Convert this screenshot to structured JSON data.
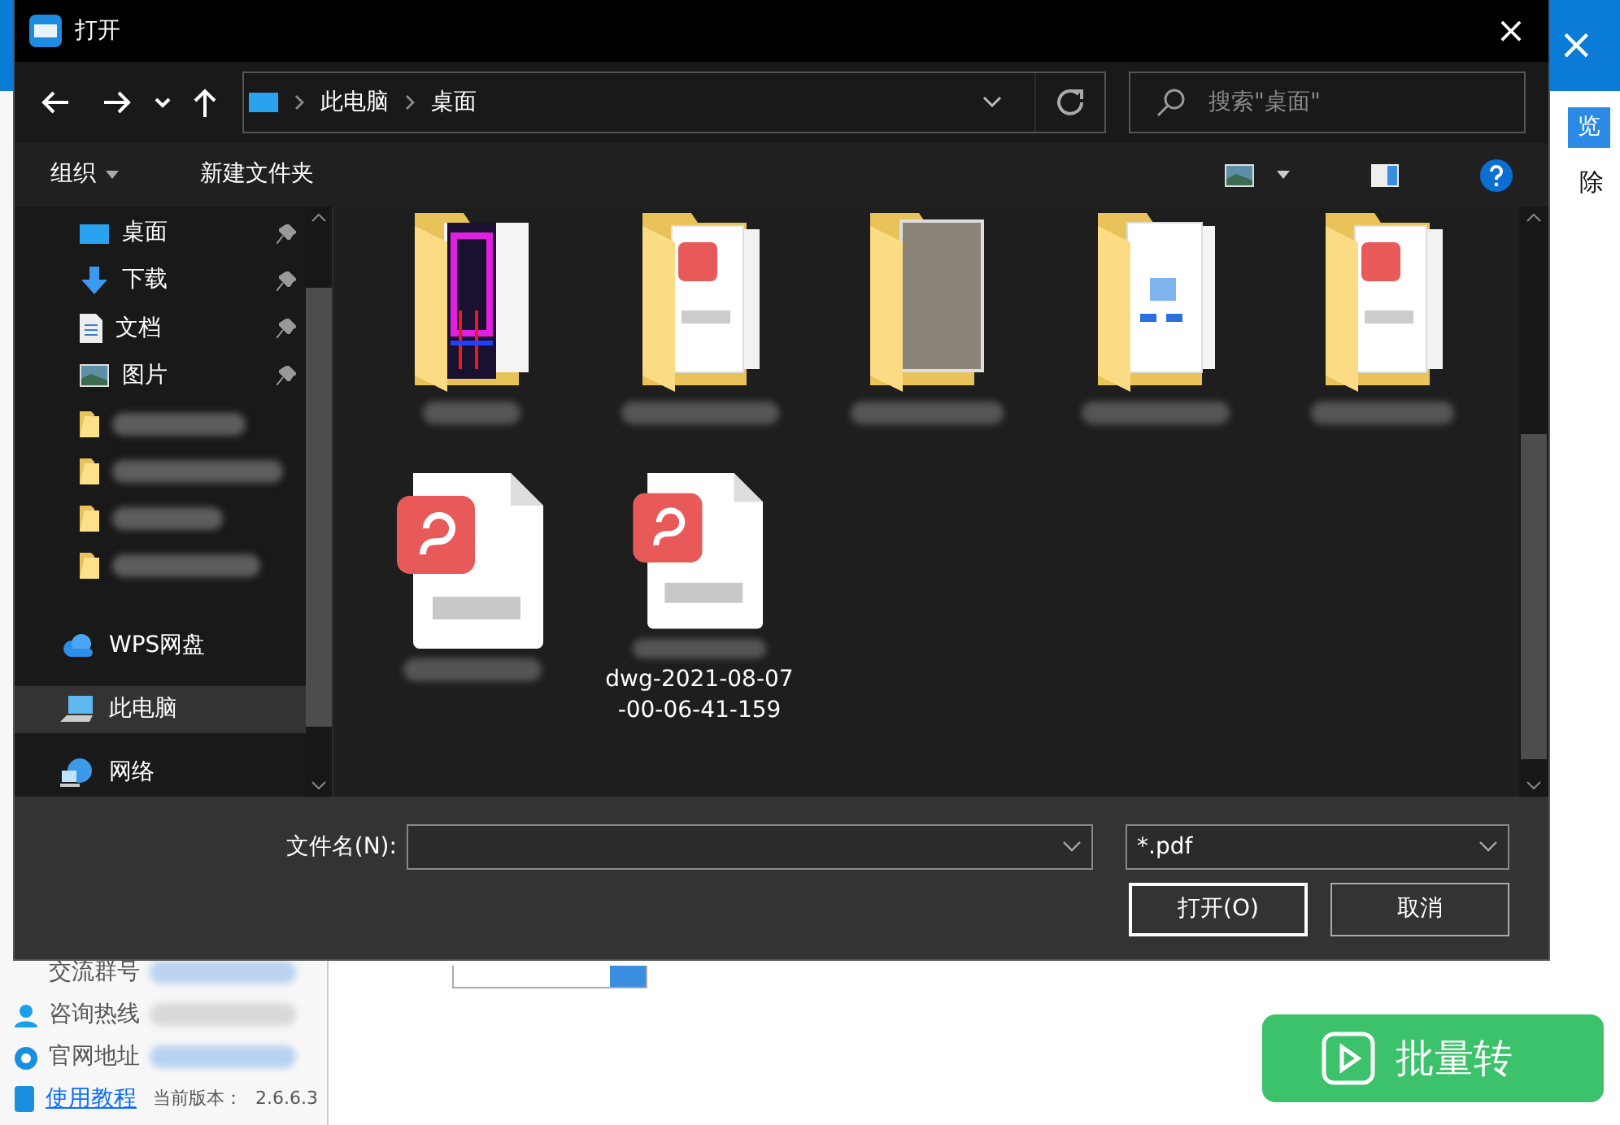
{
  "app": {
    "close": "×",
    "browse_button": "览",
    "delete_label": "除",
    "info": [
      {
        "kind": "group",
        "label": "交流群号"
      },
      {
        "kind": "phone",
        "label": "咨询热线"
      },
      {
        "kind": "web",
        "label": "官网地址"
      }
    ],
    "tutorial_link": "使用教程",
    "version_label": "当前版本：",
    "version": "2.6.6.3",
    "convert_button": "批量转"
  },
  "window": {
    "title": "打开",
    "close": "×"
  },
  "nav": {
    "path": [
      "此电脑",
      "桌面"
    ],
    "search_placeholder": "搜索\"桌面\""
  },
  "toolbar": {
    "organize": "组织",
    "new_folder": "新建文件夹"
  },
  "sidebar": {
    "items": [
      {
        "kind": "desktop",
        "label": "桌面",
        "pinned": true,
        "selected": false
      },
      {
        "kind": "download",
        "label": "下载",
        "pinned": true,
        "selected": false
      },
      {
        "kind": "document",
        "label": "文档",
        "pinned": true,
        "selected": false
      },
      {
        "kind": "picture",
        "label": "图片",
        "pinned": true,
        "selected": false
      },
      {
        "kind": "folder",
        "pinned": false,
        "selected": false
      },
      {
        "kind": "folder",
        "pinned": false,
        "selected": false
      },
      {
        "kind": "folder",
        "pinned": false,
        "selected": false
      },
      {
        "kind": "folder",
        "pinned": false,
        "selected": false
      },
      {
        "kind": "cloud",
        "label": "WPS网盘",
        "pinned": false,
        "selected": false
      },
      {
        "kind": "pc",
        "label": "此电脑",
        "pinned": false,
        "selected": true
      },
      {
        "kind": "network",
        "label": "网络",
        "pinned": false,
        "selected": false
      }
    ]
  },
  "files": [
    {
      "kind": "folder-drawing"
    },
    {
      "kind": "folder-pdf"
    },
    {
      "kind": "folder-photo"
    },
    {
      "kind": "folder-pages"
    },
    {
      "kind": "folder-pdf"
    },
    {
      "kind": "pdf"
    },
    {
      "kind": "pdf",
      "name": "dwg-2021-08-07-00-06-41-159"
    }
  ],
  "footer": {
    "filename_label": "文件名(N):",
    "filetype": "*.pdf",
    "open_button": "打开(O)",
    "cancel_button": "取消"
  }
}
